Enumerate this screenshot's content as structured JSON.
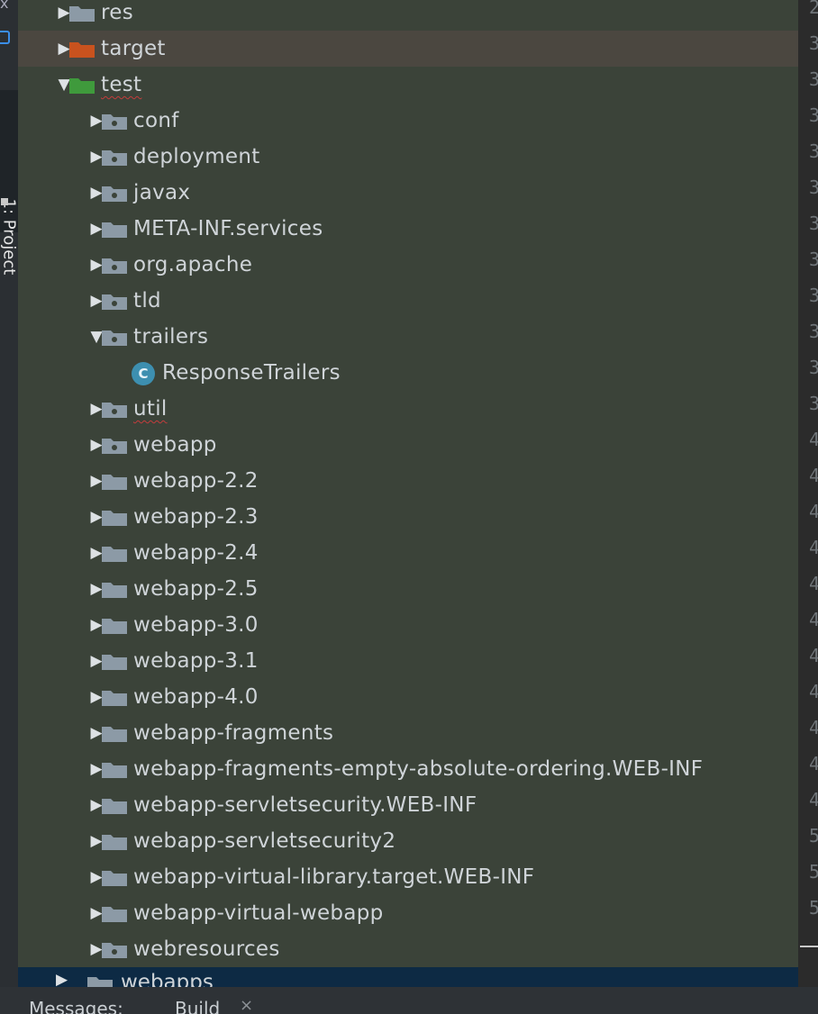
{
  "sidebar": {
    "tab_label": "1: Project"
  },
  "colors": {
    "folder_default": "#8c9aa6",
    "folder_target": "#c9521e",
    "folder_test": "#3f9a3c",
    "selected_row": "#4b4740",
    "panel_bg": "#3b4339",
    "class_icon": "#3d8fb0"
  },
  "tree": {
    "rows": [
      {
        "label": "res",
        "arrow": "collapsed",
        "icon": "folder-icon",
        "depth": 1
      },
      {
        "label": "target",
        "arrow": "collapsed",
        "icon": "excluded-folder-icon",
        "depth": 1,
        "selected": true
      },
      {
        "label": "test",
        "arrow": "expanded",
        "icon": "test-folder-icon",
        "depth": 1,
        "squiggle": true
      },
      {
        "label": "conf",
        "arrow": "collapsed",
        "icon": "package-icon",
        "depth": 2
      },
      {
        "label": "deployment",
        "arrow": "collapsed",
        "icon": "package-icon",
        "depth": 2
      },
      {
        "label": "javax",
        "arrow": "collapsed",
        "icon": "package-icon",
        "depth": 2
      },
      {
        "label": "META-INF.services",
        "arrow": "collapsed",
        "icon": "folder-icon",
        "depth": 2
      },
      {
        "label": "org.apache",
        "arrow": "collapsed",
        "icon": "package-icon",
        "depth": 2
      },
      {
        "label": "tld",
        "arrow": "collapsed",
        "icon": "package-icon",
        "depth": 2
      },
      {
        "label": "trailers",
        "arrow": "expanded",
        "icon": "package-icon",
        "depth": 2
      },
      {
        "label": "ResponseTrailers",
        "arrow": "none",
        "icon": "class-icon",
        "depth": 3
      },
      {
        "label": "util",
        "arrow": "collapsed",
        "icon": "package-icon",
        "depth": 2,
        "squiggle": true
      },
      {
        "label": "webapp",
        "arrow": "collapsed",
        "icon": "package-icon",
        "depth": 2
      },
      {
        "label": "webapp-2.2",
        "arrow": "collapsed",
        "icon": "folder-icon",
        "depth": 2
      },
      {
        "label": "webapp-2.3",
        "arrow": "collapsed",
        "icon": "folder-icon",
        "depth": 2
      },
      {
        "label": "webapp-2.4",
        "arrow": "collapsed",
        "icon": "folder-icon",
        "depth": 2
      },
      {
        "label": "webapp-2.5",
        "arrow": "collapsed",
        "icon": "folder-icon",
        "depth": 2
      },
      {
        "label": "webapp-3.0",
        "arrow": "collapsed",
        "icon": "folder-icon",
        "depth": 2
      },
      {
        "label": "webapp-3.1",
        "arrow": "collapsed",
        "icon": "folder-icon",
        "depth": 2
      },
      {
        "label": "webapp-4.0",
        "arrow": "collapsed",
        "icon": "folder-icon",
        "depth": 2
      },
      {
        "label": "webapp-fragments",
        "arrow": "collapsed",
        "icon": "folder-icon",
        "depth": 2
      },
      {
        "label": "webapp-fragments-empty-absolute-ordering.WEB-INF",
        "arrow": "collapsed",
        "icon": "folder-icon",
        "depth": 2
      },
      {
        "label": "webapp-servletsecurity.WEB-INF",
        "arrow": "collapsed",
        "icon": "folder-icon",
        "depth": 2
      },
      {
        "label": "webapp-servletsecurity2",
        "arrow": "collapsed",
        "icon": "folder-icon",
        "depth": 2
      },
      {
        "label": "webapp-virtual-library.target.WEB-INF",
        "arrow": "collapsed",
        "icon": "folder-icon",
        "depth": 2
      },
      {
        "label": "webapp-virtual-webapp",
        "arrow": "collapsed",
        "icon": "folder-icon",
        "depth": 2
      },
      {
        "label": "webresources",
        "arrow": "collapsed",
        "icon": "package-icon",
        "depth": 2
      }
    ],
    "partial_row": {
      "label": "webapps",
      "arrow": "collapsed",
      "icon": "folder-icon",
      "depth": 1
    }
  },
  "gutter": {
    "line_numbers": [
      "2",
      "3",
      "3",
      "3",
      "3",
      "3",
      "3",
      "3",
      "3",
      "3",
      "3",
      "3",
      "4",
      "4",
      "4",
      "4",
      "4",
      "4",
      "4",
      "4",
      "4",
      "4",
      "4",
      "5",
      "5",
      "5"
    ]
  },
  "bottom_bar": {
    "messages_label": "Messages:",
    "build_tab": "Build",
    "close_glyph": "×"
  }
}
